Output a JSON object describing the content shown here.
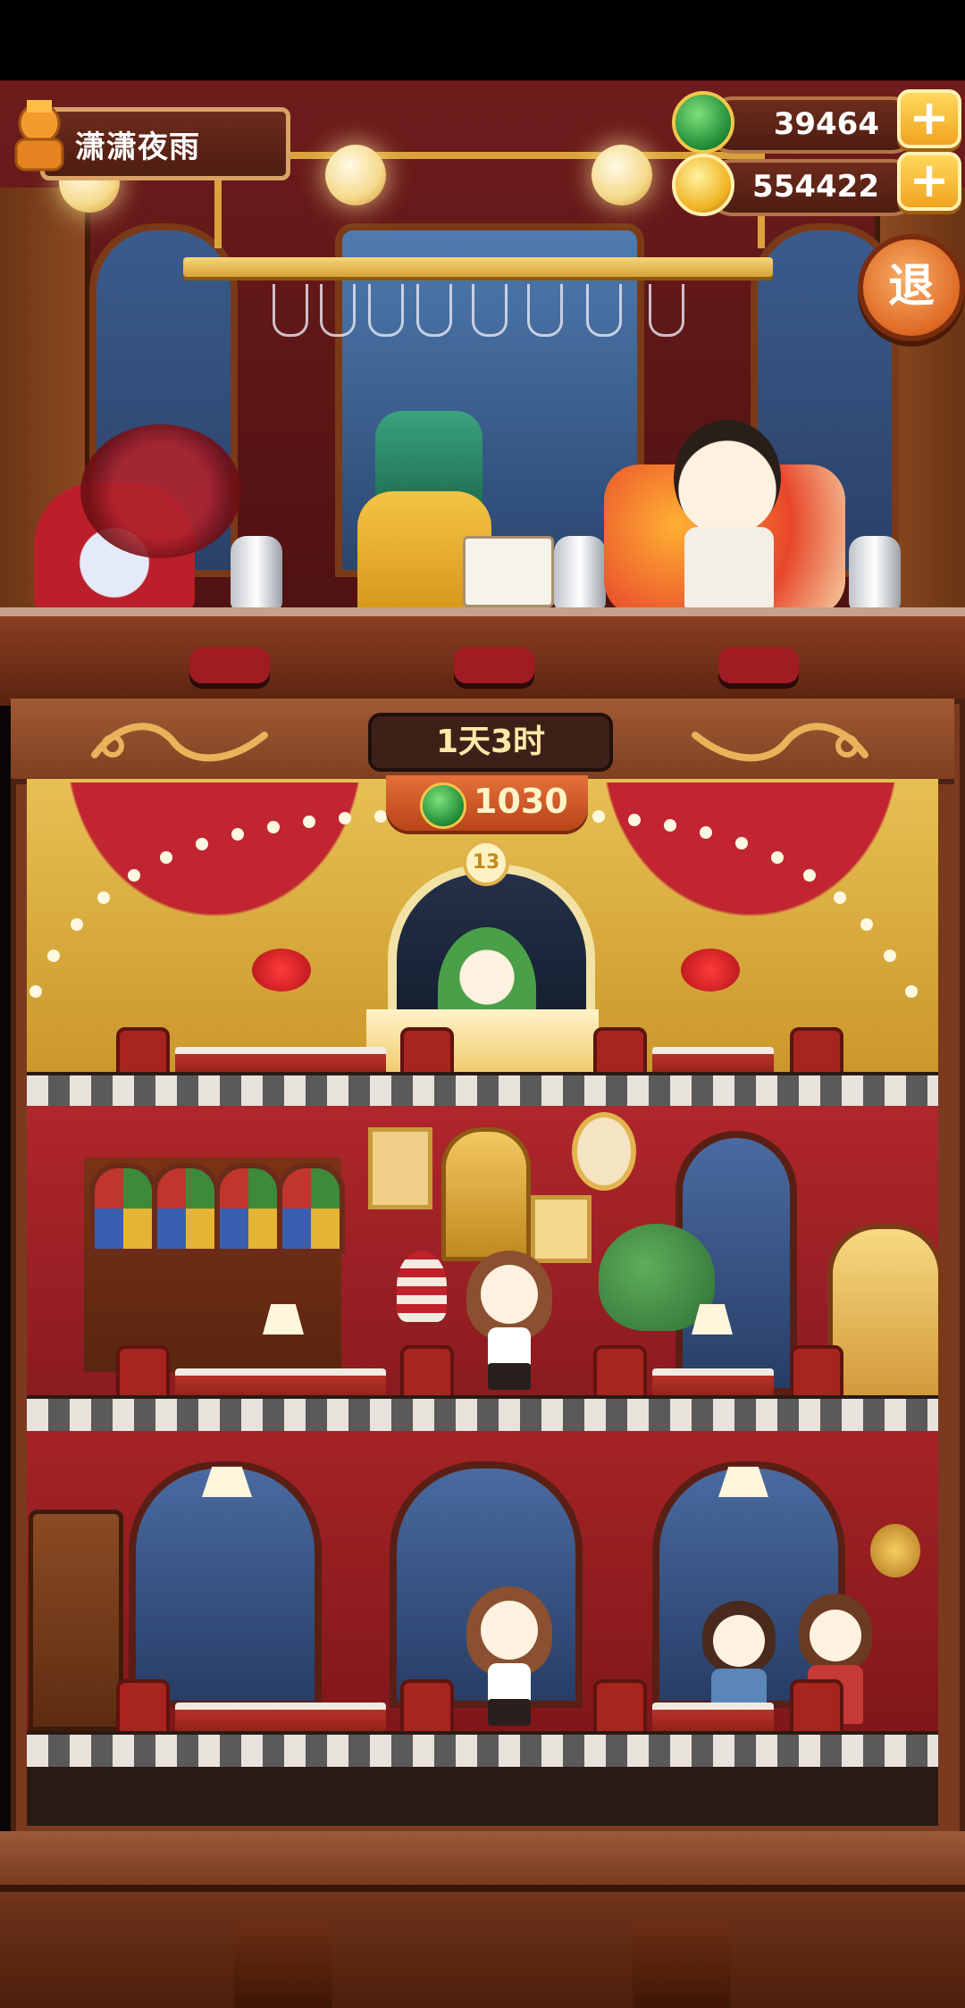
{
  "player": {
    "name": "潇潇夜雨"
  },
  "currencies": {
    "gems": {
      "value": "39464",
      "icon": "green-gem-icon"
    },
    "coins": {
      "value": "554422",
      "icon": "gold-coin-icon"
    }
  },
  "buttons": {
    "plus": "+",
    "exit_label": "退"
  },
  "hotel": {
    "timer": "1天3时",
    "floor1_reward": "1030",
    "floor1_sign": "13"
  },
  "colors": {
    "primary_wood": "#7a3a1f",
    "gold": "#f0a420",
    "bar_red": "#6e1c1c"
  }
}
